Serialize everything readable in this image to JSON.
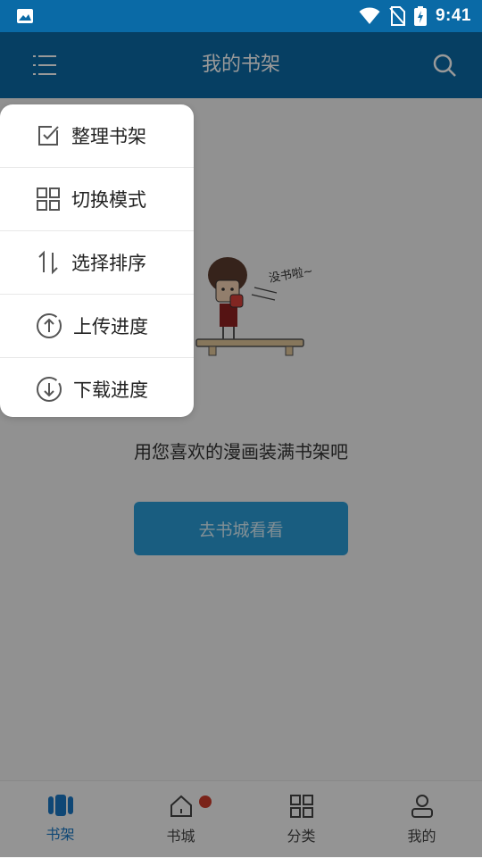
{
  "status": {
    "time": "9:41"
  },
  "header": {
    "title": "我的书架"
  },
  "empty_state": {
    "message": "用您喜欢的漫画装满书架吧",
    "cta": "去书城看看",
    "illustration_text": "没书啦~"
  },
  "popup_menu": {
    "items": [
      {
        "label": "整理书架",
        "icon": "edit-checkbox-icon"
      },
      {
        "label": "切换模式",
        "icon": "grid-icon"
      },
      {
        "label": "选择排序",
        "icon": "sort-arrows-icon"
      },
      {
        "label": "上传进度",
        "icon": "upload-circle-icon"
      },
      {
        "label": "下载进度",
        "icon": "download-circle-icon"
      }
    ]
  },
  "bottom_nav": {
    "items": [
      {
        "label": "书架",
        "icon": "bookshelf-icon",
        "active": true
      },
      {
        "label": "书城",
        "icon": "home-icon",
        "badge": true
      },
      {
        "label": "分类",
        "icon": "category-grid-icon"
      },
      {
        "label": "我的",
        "icon": "user-icon"
      }
    ]
  },
  "colors": {
    "primary": "#0a6aa6",
    "accent": "#1977c4",
    "button": "#2a9bd6",
    "badge": "#cc3b2b"
  }
}
